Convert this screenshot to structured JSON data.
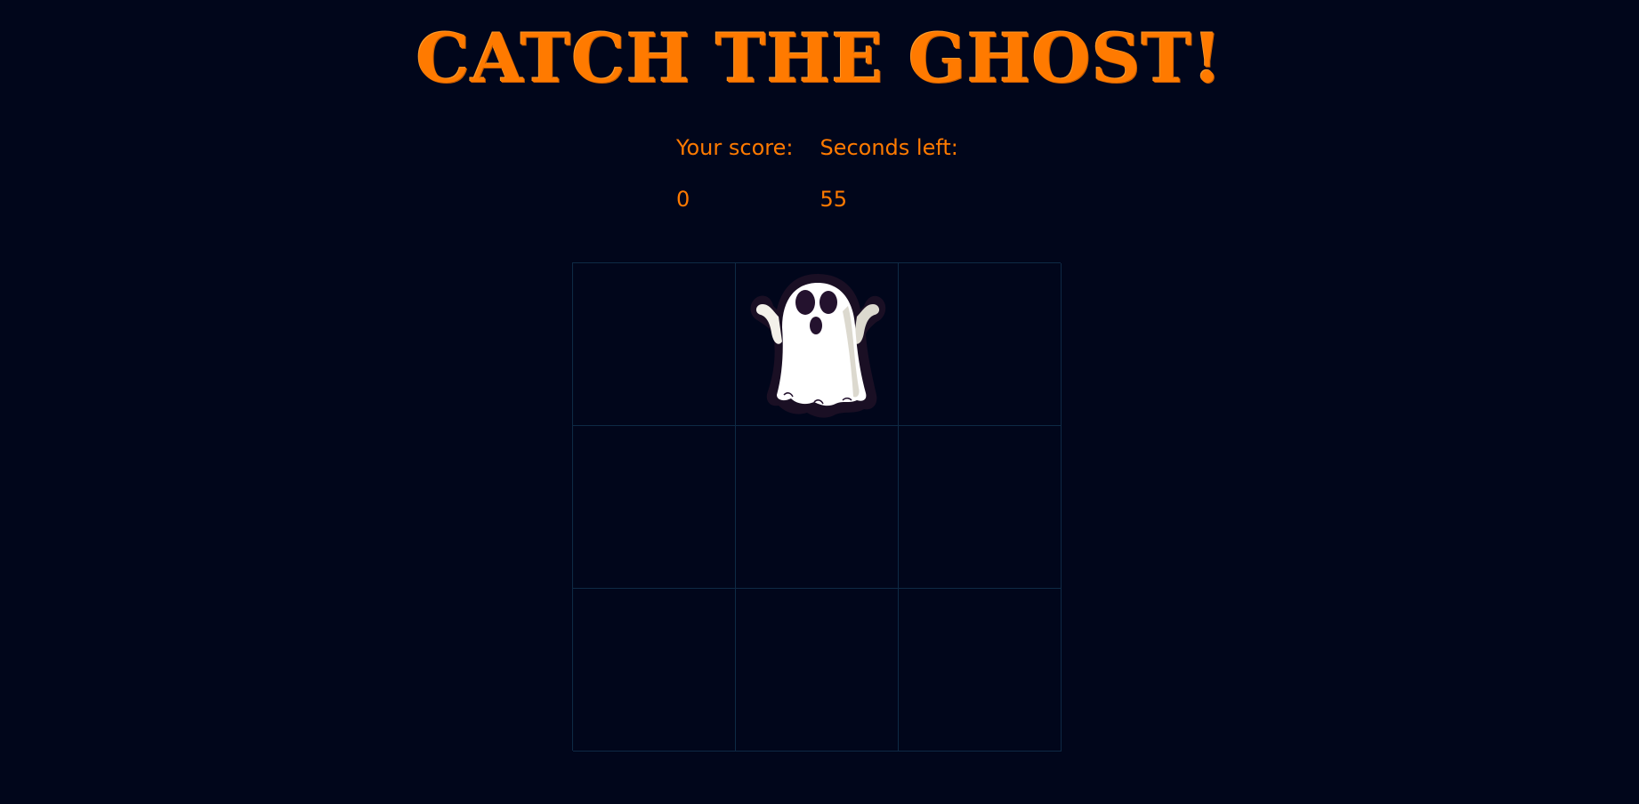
{
  "title": "CATCH THE GHOST!",
  "score": {
    "label": "Your score:",
    "value": "0"
  },
  "timer": {
    "label": "Seconds left:",
    "value": "55"
  },
  "board": {
    "rows": 3,
    "cols": 3,
    "ghost_cell": 1
  },
  "colors": {
    "background": "#01061b",
    "accent": "#ff7a00",
    "grid_line": "#0e2a45"
  },
  "icons": {
    "ghost": "ghost-icon"
  }
}
